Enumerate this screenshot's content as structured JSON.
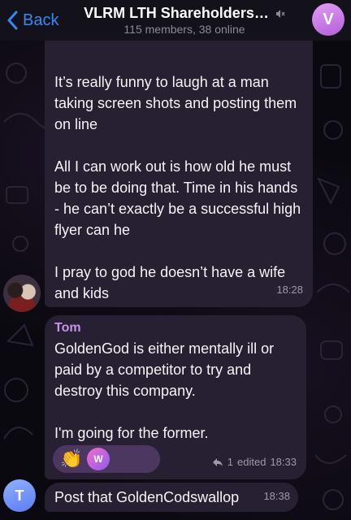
{
  "header": {
    "back_label": "Back",
    "title": "VLRM LTH Shareholders…",
    "subtitle": "115 members, 38 online",
    "avatar_letter": "V",
    "mute_icon": "mute-icon"
  },
  "messages": [
    {
      "paragraphs": [
        "It’s really funny to laugh at a man taking screen shots and posting them on line",
        "All I can work out is how old he must be to be doing that. Time in his hands - he can’t exactly be a successful high flyer can he",
        "I pray to god he doesn’t have a wife and kids"
      ],
      "time": "18:28"
    },
    {
      "sender": "Tom",
      "paragraphs": [
        "GoldenGod is either mentally ill or paid by a competitor to try and destroy this company.",
        "I'm going for the former."
      ],
      "reactions": {
        "emoji": "👏",
        "avatar_letters": "W"
      },
      "reply_count": "1",
      "edited_label": "edited",
      "time": "18:33"
    },
    {
      "text": "Post that GoldenCodswallop",
      "time": "18:38",
      "avatar_letter": "T"
    }
  ],
  "colors": {
    "accent": "#2f8cf7",
    "sender_name": "#c792ea",
    "bubble": "#282134",
    "header_avatar": "#d07de8"
  }
}
